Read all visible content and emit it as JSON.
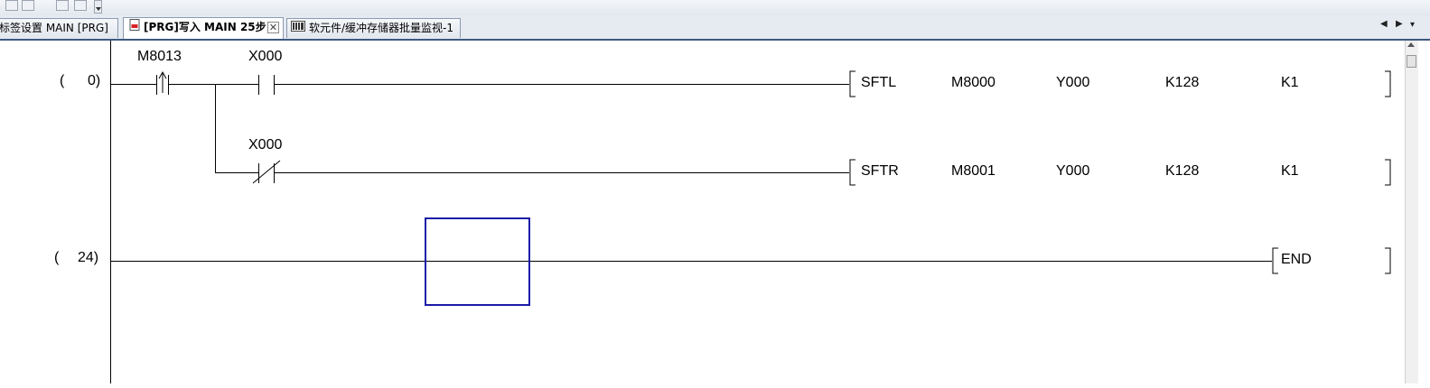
{
  "toolbar": {
    "buttons": [
      "toolbar-button-1",
      "toolbar-button-2",
      "toolbar-button-3",
      "toolbar-button-4"
    ]
  },
  "tabs": [
    {
      "label": "标签设置 MAIN [PRG]",
      "active": false
    },
    {
      "label": "[PRG]写入 MAIN 25步",
      "active": true,
      "icon": "program-icon",
      "close": "✕"
    },
    {
      "label": "软元件/缓冲存储器批量监视-1",
      "active": false,
      "icon": "monitor-icon"
    }
  ],
  "tab_nav": {
    "prev": "◀",
    "next": "▶",
    "menu": "▾"
  },
  "ladder": {
    "rungs": [
      {
        "step_open": "(",
        "step": "0)",
        "contacts": [
          {
            "device": "M8013",
            "type": "rising-edge"
          },
          {
            "device": "X000",
            "type": "normally-open"
          }
        ],
        "instruction": {
          "mnemonic": "SFTL",
          "operands": [
            "M8000",
            "Y000",
            "K128",
            "K1"
          ]
        }
      },
      {
        "branch": true,
        "contacts": [
          {
            "device": "X000",
            "type": "normally-closed"
          }
        ],
        "instruction": {
          "mnemonic": "SFTR",
          "operands": [
            "M8001",
            "Y000",
            "K128",
            "K1"
          ]
        }
      },
      {
        "step_open": "(",
        "step": "24)",
        "instruction": {
          "mnemonic": "END",
          "operands": []
        }
      }
    ],
    "cursor_color": "#1a1aa6"
  }
}
